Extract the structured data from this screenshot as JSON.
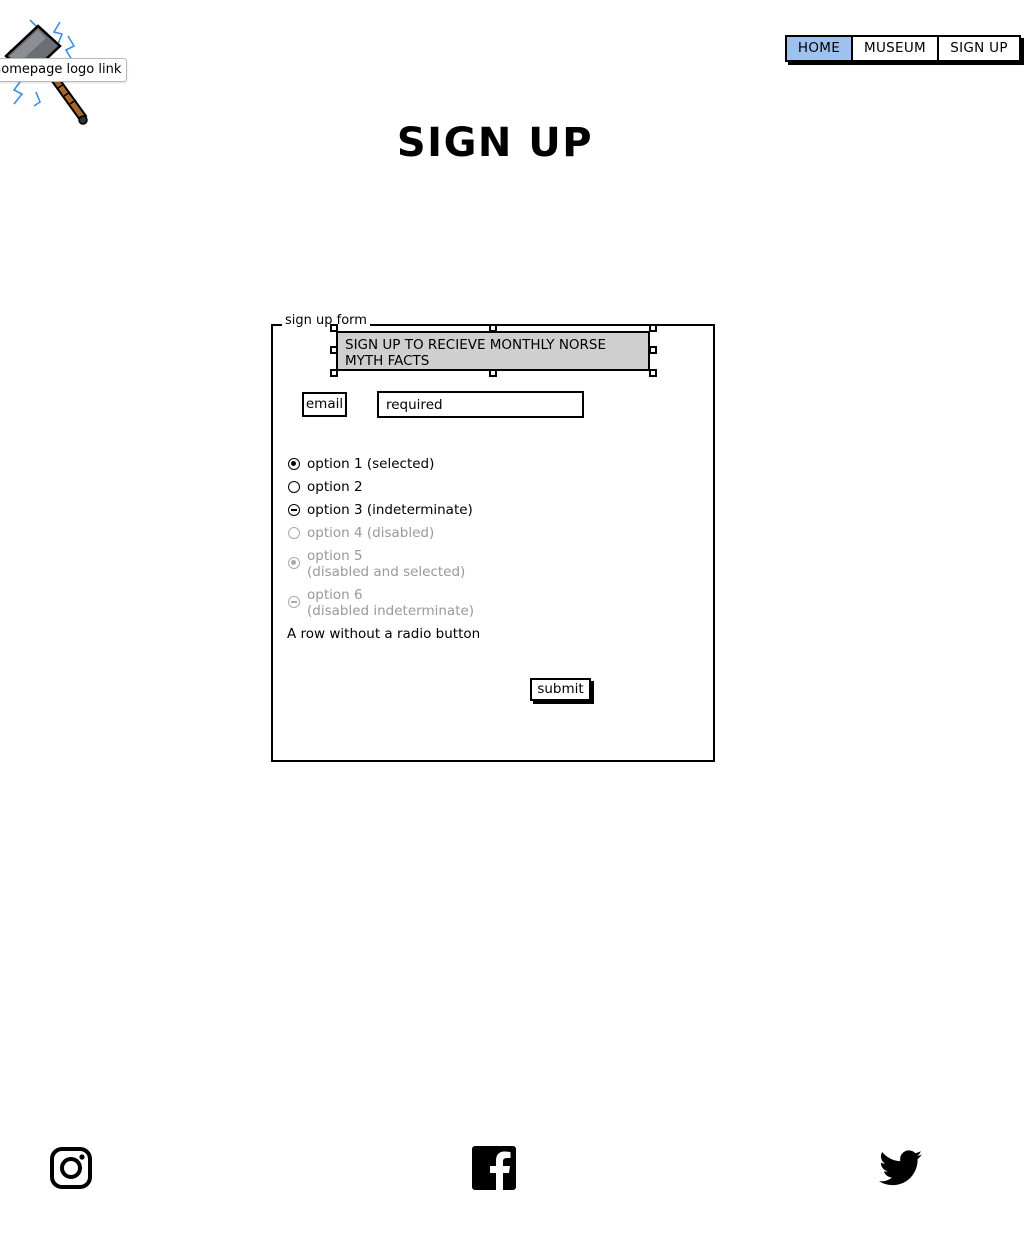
{
  "logo": {
    "tooltip": "homepage logo link",
    "icon": "hammer-icon"
  },
  "nav": {
    "items": [
      {
        "label": "HOME",
        "active": true
      },
      {
        "label": "MUSEUM",
        "active": false
      },
      {
        "label": "SIGN UP",
        "active": false
      }
    ],
    "active_color": "#9fc1f0"
  },
  "page": {
    "title": "SIGN UP"
  },
  "form": {
    "legend": "sign up form",
    "banner": "SIGN UP TO RECIEVE MONTHLY NORSE MYTH FACTS",
    "email_label": "email",
    "email_placeholder": "required",
    "radios": [
      {
        "label": "option 1 (selected)",
        "state": "selected",
        "disabled": false
      },
      {
        "label": "option 2",
        "state": "unselected",
        "disabled": false
      },
      {
        "label": "option 3 (indeterminate)",
        "state": "indeterminate",
        "disabled": false
      },
      {
        "label": "option 4 (disabled)",
        "state": "unselected",
        "disabled": true
      },
      {
        "label": "option 5",
        "label_line2": "(disabled and selected)",
        "state": "selected",
        "disabled": true
      },
      {
        "label": "option 6",
        "label_line2": "(disabled indeterminate)",
        "state": "indeterminate",
        "disabled": true
      }
    ],
    "plain_row": "A row without a radio button",
    "submit_label": "submit"
  },
  "footer": {
    "icons": [
      "instagram-icon",
      "facebook-icon",
      "twitter-icon"
    ]
  }
}
